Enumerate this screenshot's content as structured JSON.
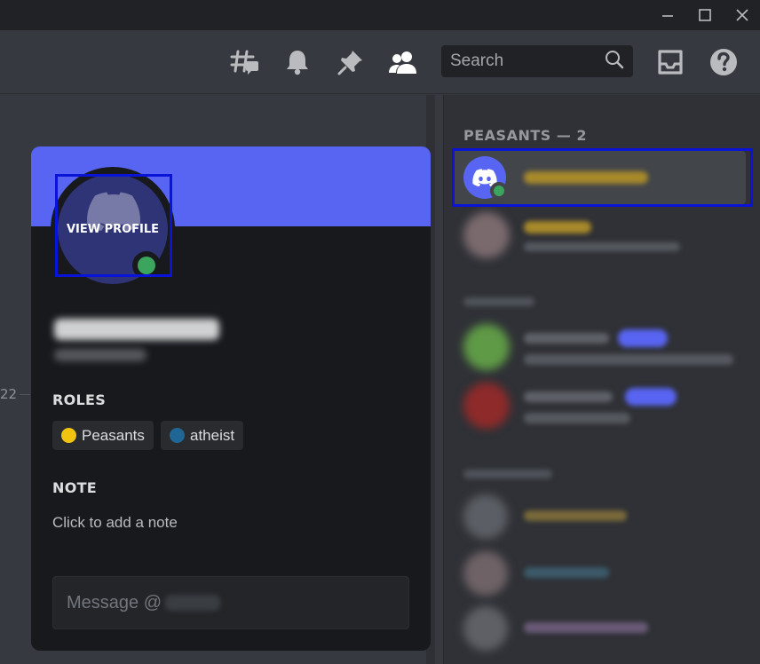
{
  "window": {
    "controls": [
      "minimize-icon",
      "maximize-icon",
      "close-icon"
    ]
  },
  "toolbar": {
    "icons": [
      "threads-icon",
      "bell-icon",
      "pin-icon",
      "members-icon",
      "inbox-icon",
      "help-icon"
    ],
    "search_placeholder": "Search"
  },
  "chat": {
    "timestamp_fragment": "22"
  },
  "popout": {
    "view_profile_label": "VIEW PROFILE",
    "status": "online",
    "roles_title": "ROLES",
    "roles": [
      {
        "name": "Peasants",
        "color": "#f1c40f"
      },
      {
        "name": "atheist",
        "color": "#206694"
      }
    ],
    "note_title": "NOTE",
    "note_placeholder": "Click to add a note",
    "message_placeholder": "Message @"
  },
  "members": {
    "groups": [
      {
        "header": "PEASANTS — 2"
      }
    ]
  },
  "colors": {
    "banner": "#5865f2",
    "online": "#3ba55d",
    "highlight": "#0a13d8"
  }
}
